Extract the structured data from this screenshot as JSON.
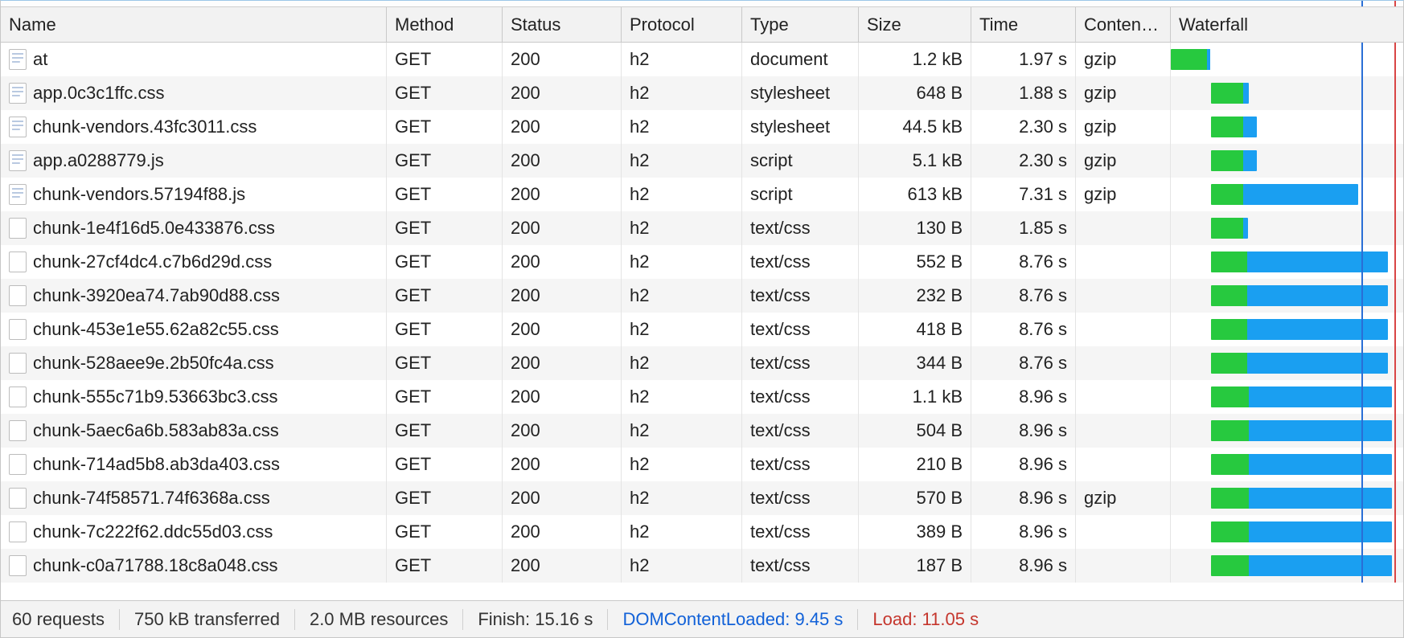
{
  "columns": {
    "name": "Name",
    "method": "Method",
    "status": "Status",
    "protocol": "Protocol",
    "type": "Type",
    "size": "Size",
    "time": "Time",
    "content": "Conten…",
    "waterfall": "Waterfall"
  },
  "timeline": {
    "total_s": 15.16,
    "dcl_s": 9.45,
    "load_s": 11.05
  },
  "rows": [
    {
      "name": "at",
      "icon": "doc",
      "method": "GET",
      "status": "200",
      "protocol": "h2",
      "type": "document",
      "size": "1.2 kB",
      "time": "1.97 s",
      "content": "gzip",
      "wf": {
        "start_s": 0.0,
        "wait_s": 1.8,
        "dl_s": 0.17
      }
    },
    {
      "name": "app.0c3c1ffc.css",
      "icon": "doc",
      "method": "GET",
      "status": "200",
      "protocol": "h2",
      "type": "stylesheet",
      "size": "648 B",
      "time": "1.88 s",
      "content": "gzip",
      "wf": {
        "start_s": 1.97,
        "wait_s": 1.6,
        "dl_s": 0.28
      }
    },
    {
      "name": "chunk-vendors.43fc3011.css",
      "icon": "doc",
      "method": "GET",
      "status": "200",
      "protocol": "h2",
      "type": "stylesheet",
      "size": "44.5 kB",
      "time": "2.30 s",
      "content": "gzip",
      "wf": {
        "start_s": 1.97,
        "wait_s": 1.6,
        "dl_s": 0.7
      }
    },
    {
      "name": "app.a0288779.js",
      "icon": "doc",
      "method": "GET",
      "status": "200",
      "protocol": "h2",
      "type": "script",
      "size": "5.1 kB",
      "time": "2.30 s",
      "content": "gzip",
      "wf": {
        "start_s": 1.97,
        "wait_s": 1.6,
        "dl_s": 0.7
      }
    },
    {
      "name": "chunk-vendors.57194f88.js",
      "icon": "doc",
      "method": "GET",
      "status": "200",
      "protocol": "h2",
      "type": "script",
      "size": "613 kB",
      "time": "7.31 s",
      "content": "gzip",
      "wf": {
        "start_s": 1.97,
        "wait_s": 1.6,
        "dl_s": 5.71
      }
    },
    {
      "name": "chunk-1e4f16d5.0e433876.css",
      "icon": "",
      "method": "GET",
      "status": "200",
      "protocol": "h2",
      "type": "text/css",
      "size": "130 B",
      "time": "1.85 s",
      "content": "",
      "wf": {
        "start_s": 1.97,
        "wait_s": 1.6,
        "dl_s": 0.25
      }
    },
    {
      "name": "chunk-27cf4dc4.c7b6d29d.css",
      "icon": "",
      "method": "GET",
      "status": "200",
      "protocol": "h2",
      "type": "text/css",
      "size": "552 B",
      "time": "8.76 s",
      "content": "",
      "wf": {
        "start_s": 1.97,
        "wait_s": 1.8,
        "dl_s": 6.96
      }
    },
    {
      "name": "chunk-3920ea74.7ab90d88.css",
      "icon": "",
      "method": "GET",
      "status": "200",
      "protocol": "h2",
      "type": "text/css",
      "size": "232 B",
      "time": "8.76 s",
      "content": "",
      "wf": {
        "start_s": 1.97,
        "wait_s": 1.8,
        "dl_s": 6.96
      }
    },
    {
      "name": "chunk-453e1e55.62a82c55.css",
      "icon": "",
      "method": "GET",
      "status": "200",
      "protocol": "h2",
      "type": "text/css",
      "size": "418 B",
      "time": "8.76 s",
      "content": "",
      "wf": {
        "start_s": 1.97,
        "wait_s": 1.8,
        "dl_s": 6.96
      }
    },
    {
      "name": "chunk-528aee9e.2b50fc4a.css",
      "icon": "",
      "method": "GET",
      "status": "200",
      "protocol": "h2",
      "type": "text/css",
      "size": "344 B",
      "time": "8.76 s",
      "content": "",
      "wf": {
        "start_s": 1.97,
        "wait_s": 1.8,
        "dl_s": 6.96
      }
    },
    {
      "name": "chunk-555c71b9.53663bc3.css",
      "icon": "",
      "method": "GET",
      "status": "200",
      "protocol": "h2",
      "type": "text/css",
      "size": "1.1 kB",
      "time": "8.96 s",
      "content": "",
      "wf": {
        "start_s": 1.97,
        "wait_s": 1.9,
        "dl_s": 7.06
      }
    },
    {
      "name": "chunk-5aec6a6b.583ab83a.css",
      "icon": "",
      "method": "GET",
      "status": "200",
      "protocol": "h2",
      "type": "text/css",
      "size": "504 B",
      "time": "8.96 s",
      "content": "",
      "wf": {
        "start_s": 1.97,
        "wait_s": 1.9,
        "dl_s": 7.06
      }
    },
    {
      "name": "chunk-714ad5b8.ab3da403.css",
      "icon": "",
      "method": "GET",
      "status": "200",
      "protocol": "h2",
      "type": "text/css",
      "size": "210 B",
      "time": "8.96 s",
      "content": "",
      "wf": {
        "start_s": 1.97,
        "wait_s": 1.9,
        "dl_s": 7.06
      }
    },
    {
      "name": "chunk-74f58571.74f6368a.css",
      "icon": "",
      "method": "GET",
      "status": "200",
      "protocol": "h2",
      "type": "text/css",
      "size": "570 B",
      "time": "8.96 s",
      "content": "gzip",
      "wf": {
        "start_s": 1.97,
        "wait_s": 1.9,
        "dl_s": 7.06
      }
    },
    {
      "name": "chunk-7c222f62.ddc55d03.css",
      "icon": "",
      "method": "GET",
      "status": "200",
      "protocol": "h2",
      "type": "text/css",
      "size": "389 B",
      "time": "8.96 s",
      "content": "",
      "wf": {
        "start_s": 1.97,
        "wait_s": 1.9,
        "dl_s": 7.06
      }
    },
    {
      "name": "chunk-c0a71788.18c8a048.css",
      "icon": "",
      "method": "GET",
      "status": "200",
      "protocol": "h2",
      "type": "text/css",
      "size": "187 B",
      "time": "8.96 s",
      "content": "",
      "wf": {
        "start_s": 1.97,
        "wait_s": 1.9,
        "dl_s": 7.06
      }
    }
  ],
  "statusbar": {
    "requests": "60 requests",
    "transferred": "750 kB transferred",
    "resources": "2.0 MB resources",
    "finish": "Finish: 15.16 s",
    "dcl": "DOMContentLoaded: 9.45 s",
    "load": "Load: 11.05 s"
  }
}
